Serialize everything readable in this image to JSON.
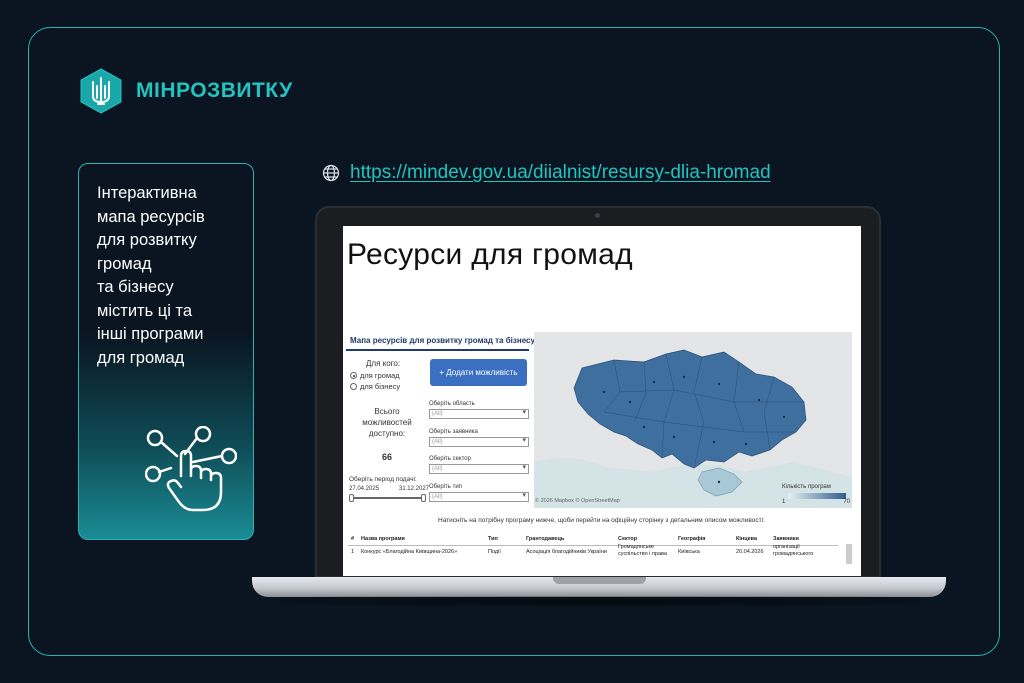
{
  "brand": {
    "name": "МІНРОЗВИТКУ",
    "accent": "#23c3c0"
  },
  "card": {
    "lines": [
      "Інтерактивна",
      "мапа ресурсів",
      "для розвитку",
      "громад",
      "та бізнесу",
      "містить ці та",
      "інші програми",
      "для громад"
    ],
    "icon": "touch-network-icon"
  },
  "link": {
    "icon": "globe-icon",
    "url": "https://mindev.gov.ua/diialnist/resursy-dlia-hromad"
  },
  "screen": {
    "title": "Ресурси для громад",
    "map_title": "Мапа ресурсів для розвитку громад та бізнесу",
    "for_who_label": "Для кого:",
    "radio_options": [
      "для громад",
      "для бізнесу"
    ],
    "add_button": "+ Додати можливість",
    "total_label": "Всього можливостей доступно:",
    "total_value": "66",
    "period_label": "Оберіть період подачі:",
    "period_from": "27.04.2025",
    "period_to": "31.12.2027",
    "filters": [
      {
        "label": "Оберіть область",
        "value": "(All)"
      },
      {
        "label": "Оберіть заявника",
        "value": "(All)"
      },
      {
        "label": "Оберіть сектор",
        "value": "(All)"
      },
      {
        "label": "Оберіть тип",
        "value": "(All)"
      }
    ],
    "legend_title": "Кількість програм",
    "legend_min": "1",
    "legend_max": "70",
    "attribution": "© 2026 Mapbox © OpenStreetMap",
    "hint": "Натисніть на потрібну програму нижче, щоби перейти на офіційну сторінку з детальним описом можливості:",
    "table": {
      "headers": [
        "#",
        "Назва програми",
        "Тип",
        "Грантодавець",
        "Сектор",
        "Географія",
        "Кінцева",
        "Заявники"
      ],
      "row": [
        "1",
        "Конкурс «Благодійна Київщина-2026»",
        "Події",
        "Асоціація благодійників України",
        "Громадянське суспільство і права",
        "Київська",
        "20.04.2026",
        "організації громадянського"
      ]
    }
  }
}
